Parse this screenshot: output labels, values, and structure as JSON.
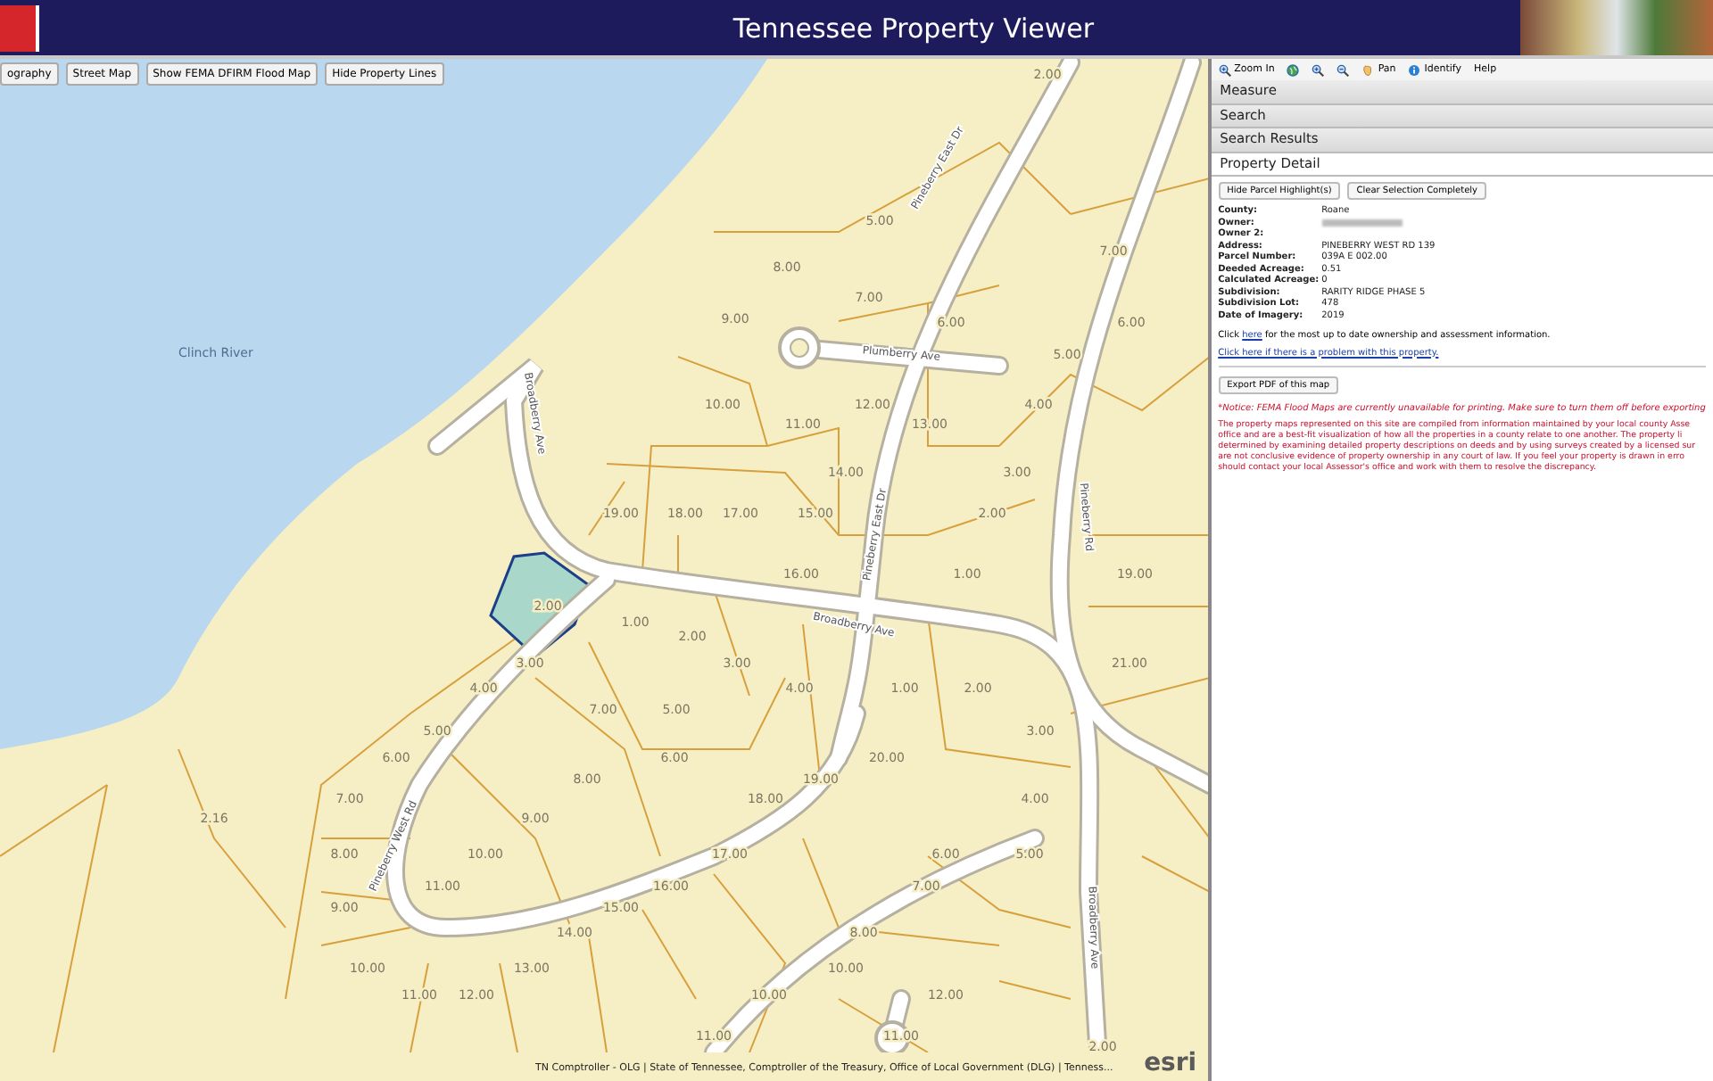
{
  "header": {
    "title": "Tennessee Property Viewer"
  },
  "map": {
    "basemap_buttons": [
      "ography",
      "Street Map",
      "Show FEMA DFIRM Flood Map",
      "Hide Property Lines"
    ],
    "water_label": "Clinch River",
    "lot_labels": [
      "2.00",
      "5.00",
      "7.00",
      "8.00",
      "7.00",
      "9.00",
      "6.00",
      "6.00",
      "5.00",
      "10.00",
      "12.00",
      "4.00",
      "11.00",
      "13.00",
      "14.00",
      "3.00",
      "19.00",
      "18.00",
      "17.00",
      "15.00",
      "2.00",
      "16.00",
      "1.00",
      "19.00",
      "2.00",
      "1.00",
      "2.00",
      "3.00",
      "3.00",
      "21.00",
      "4.00",
      "4.00",
      "1.00",
      "2.00",
      "7.00",
      "5.00",
      "5.00",
      "3.00",
      "6.00",
      "6.00",
      "20.00",
      "8.00",
      "19.00",
      "7.00",
      "18.00",
      "4.00",
      "2.16",
      "9.00",
      "8.00",
      "10.00",
      "17.00",
      "6.00",
      "5.00",
      "11.00",
      "16.00",
      "7.00",
      "9.00",
      "15.00",
      "14.00",
      "8.00",
      "10.00",
      "13.00",
      "10.00",
      "11.00",
      "12.00",
      "10.00",
      "12.00",
      "11.00",
      "11.00",
      "2.00"
    ],
    "street_labels": [
      "Plumberry Ave",
      "Pineberry East Dr",
      "Pineberry East Dr",
      "Broadberry Ave",
      "Broadberry Ave",
      "Broadberry Ave",
      "Pineberry West Rd",
      "Pineberry Rd"
    ],
    "attribution": "TN Comptroller - OLG | State of Tennessee, Comptroller of the Treasury, Office of Local Government (DLG) | Tenness...",
    "logo": "esri"
  },
  "tools": [
    {
      "kind": "zoom-in",
      "label": "Zoom In"
    },
    {
      "kind": "globe"
    },
    {
      "kind": "zoom-in"
    },
    {
      "kind": "zoom-out"
    },
    {
      "kind": "pan",
      "label": "Pan"
    },
    {
      "kind": "info",
      "label": "Identify"
    },
    {
      "kind": "none",
      "label": "Help"
    }
  ],
  "sections": [
    {
      "label": "Measure",
      "expanded": false
    },
    {
      "label": "Search",
      "expanded": false
    },
    {
      "label": "Search Results",
      "expanded": false
    },
    {
      "label": "Property Detail",
      "expanded": true
    }
  ],
  "detail": {
    "buttons": [
      "Hide Parcel Highlight(s)",
      "Clear Selection Completely"
    ],
    "fields": [
      {
        "label": "County:",
        "value": "Roane"
      },
      {
        "label": "Owner:",
        "redacted": true
      },
      {
        "label": "Owner 2:"
      },
      {
        "label": "Address:",
        "value": "PINEBERRY WEST RD 139"
      },
      {
        "label": "Parcel Number:",
        "value": "039A E 002.00"
      },
      {
        "label": "Deeded Acreage:",
        "value": "0.51"
      },
      {
        "label": "Calculated Acreage:",
        "value": "0"
      },
      {
        "label": "Subdivision:",
        "value": "RARITY RIDGE PHASE 5"
      },
      {
        "label": "Subdivision Lot:",
        "value": "478"
      },
      {
        "label": "Date of Imagery:",
        "value": "2019"
      }
    ],
    "info_before": "Click ",
    "info_link": "here",
    "info_after": " for the most up to date ownership and assessment information.",
    "problem_link": "Click here if there is a problem with this property.",
    "export_button": "Export PDF of this map",
    "notice": "*Notice: FEMA Flood Maps are currently unavailable for printing. Make sure to turn them off before exporting",
    "disclaimer_lines": [
      "The property maps represented on this site are compiled from information maintained by your local county Asse",
      "office and are a best-fit visualization of how all the properties in a county relate to one another. The property li",
      "determined by examining detailed property descriptions on deeds and by using surveys created by a licensed sur",
      "are not conclusive evidence of property ownership in any court of law. If you feel your property is drawn in erro",
      "should contact your local Assessor's office and work with them to resolve the discrepancy."
    ]
  }
}
